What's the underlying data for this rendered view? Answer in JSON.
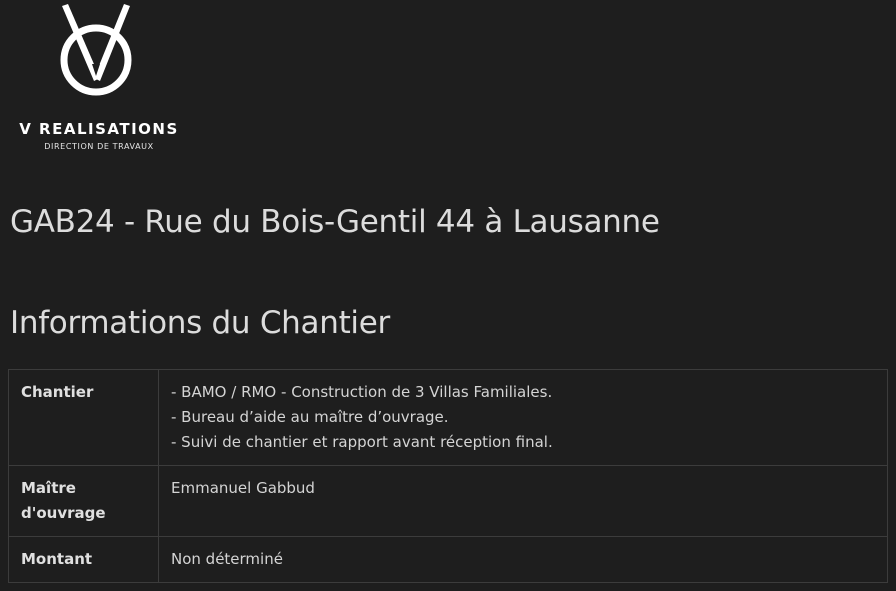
{
  "logo": {
    "title": "V REALISATIONS",
    "subtitle": "DIRECTION DE TRAVAUX"
  },
  "project": {
    "title": "GAB24 - Rue du Bois-Gentil 44 à Lausanne"
  },
  "section": {
    "title": "Informations du Chantier"
  },
  "table": {
    "rows": [
      {
        "label": "Chantier",
        "lines": [
          "- BAMO /  RMO - Construction de 3 Villas Familiales.",
          "- Bureau d’aide au maître d’ouvrage.",
          "- Suivi de chantier et rapport avant réception final."
        ]
      },
      {
        "label_line1": "Maître",
        "label_line2": "d'ouvrage",
        "value": "Emmanuel Gabbud"
      },
      {
        "label": "Montant",
        "value": "Non déterminé"
      }
    ]
  }
}
